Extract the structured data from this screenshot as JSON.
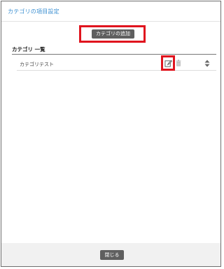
{
  "dialog": {
    "title": "カテゴリの項目設定"
  },
  "toolbar": {
    "add_label": "カテゴリの追加"
  },
  "list": {
    "heading": "カテゴリ 一覧",
    "items": [
      {
        "label": "カテゴリテスト",
        "actions": [
          "edit-icon",
          "trash-icon",
          "sort-icon"
        ]
      }
    ]
  },
  "footer": {
    "close_label": "閉じる"
  },
  "colors": {
    "title_accent": "#3b8fd1",
    "button_bg": "#5f5f5f",
    "highlight": "#e0141e",
    "footer_bg": "#f1f1f1"
  }
}
